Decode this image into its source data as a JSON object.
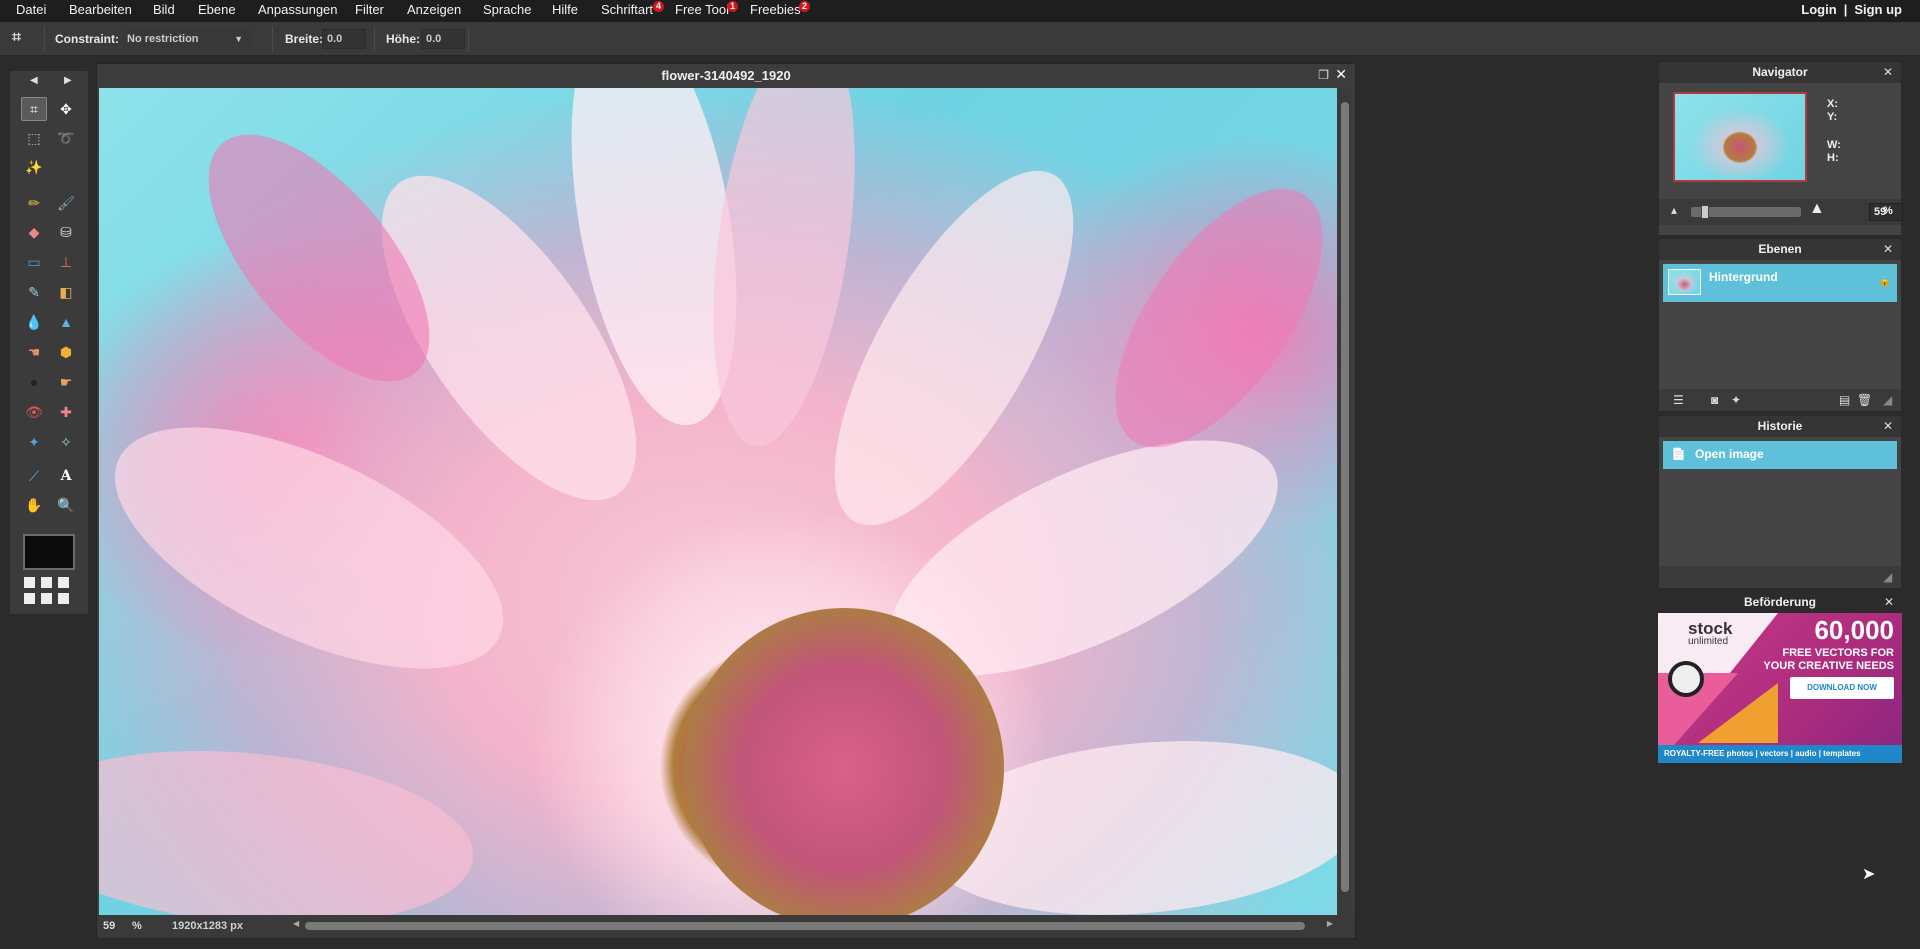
{
  "menubar": {
    "items": [
      "Datei",
      "Bearbeiten",
      "Bild",
      "Ebene",
      "Anpassungen",
      "Filter",
      "Anzeigen",
      "Sprache",
      "Hilfe",
      "Schriftart",
      "Free Tool",
      "Freebies"
    ],
    "badges": {
      "schriftart": "4",
      "free_tool": "1",
      "freebies": "2"
    },
    "login": "Login",
    "separator": "|",
    "signup": "Sign up"
  },
  "options": {
    "constraint_label": "Constraint:",
    "constraint_value": "No restriction",
    "width_label": "Breite:",
    "width_value": "0.0",
    "height_label": "Höhe:",
    "height_value": "0.0"
  },
  "canvas": {
    "title": "flower-3140492_1920",
    "zoom": "59",
    "zoom_unit": "%",
    "image_size": "1920x1283 px"
  },
  "navigator": {
    "title": "Navigator",
    "x_label": "X:",
    "y_label": "Y:",
    "w_label": "W:",
    "h_label": "H:",
    "zoom_value": "59",
    "zoom_unit": "%",
    "zoom_fraction": 0.1
  },
  "layers": {
    "title": "Ebenen",
    "items": [
      {
        "name": "Hintergrund"
      }
    ]
  },
  "history": {
    "title": "Historie",
    "items": [
      {
        "name": "Open image"
      }
    ]
  },
  "promo": {
    "title": "Beförderung",
    "brand": "stock",
    "brand_sub": "unlimited",
    "headline": "60,000",
    "line1": "FREE VECTORS FOR",
    "line2": "YOUR CREATIVE NEEDS",
    "button": "DOWNLOAD NOW",
    "footer": "ROYALTY-FREE  photos | vectors | audio | templates"
  },
  "colors": {
    "accent_selection": "#5ec1d9",
    "foreground_swatch": "#0b0b0b",
    "badge": "#d7141a"
  }
}
